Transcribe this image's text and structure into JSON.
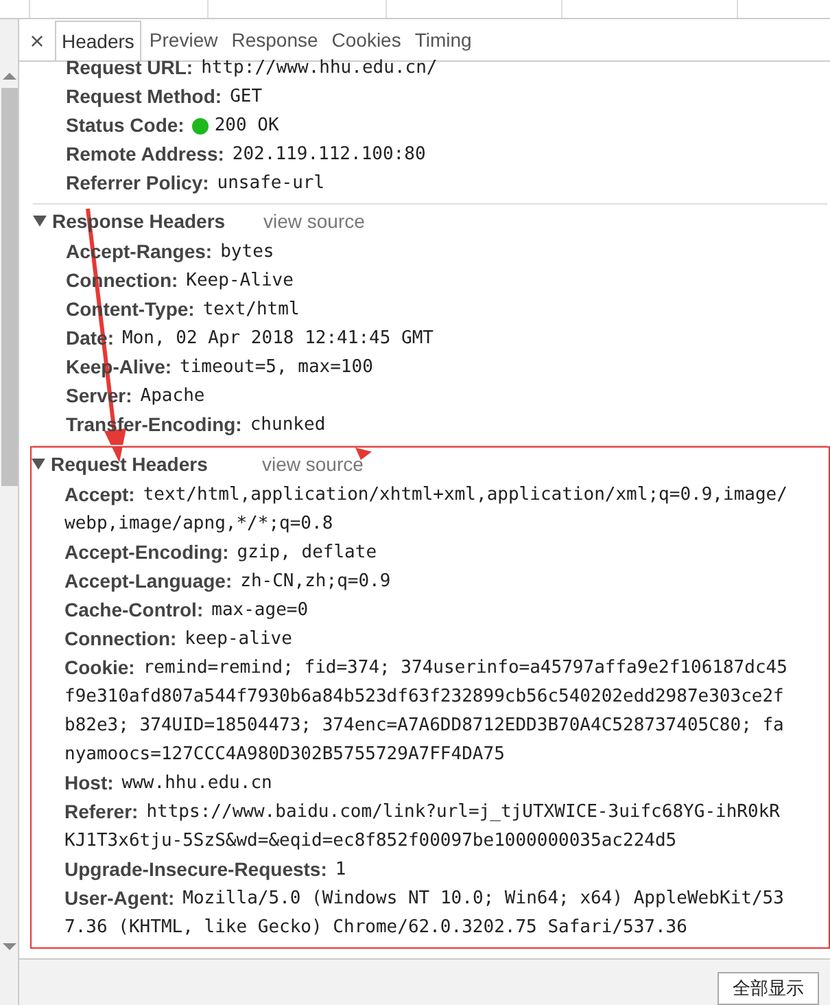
{
  "tabs": [
    {
      "label": "Headers",
      "selected": true
    },
    {
      "label": "Preview",
      "selected": false
    },
    {
      "label": "Response",
      "selected": false
    },
    {
      "label": "Cookies",
      "selected": false
    },
    {
      "label": "Timing",
      "selected": false
    }
  ],
  "close": "×",
  "general": [
    {
      "kind": "text",
      "name": "Request URL:",
      "lines": [
        "http://www.hhu.edu.cn/"
      ]
    },
    {
      "kind": "text",
      "name": "Request Method:",
      "lines": [
        "GET"
      ]
    },
    {
      "kind": "status",
      "name": "Status Code:",
      "color": "#1fb81f",
      "lines": [
        "200 OK"
      ]
    },
    {
      "kind": "text",
      "name": "Remote Address:",
      "lines": [
        "202.119.112.100:80"
      ]
    },
    {
      "kind": "text",
      "name": "Referrer Policy:",
      "lines": [
        "unsafe-url"
      ]
    }
  ],
  "sections": [
    {
      "title": "Response Headers",
      "link": "view source",
      "expanded": true,
      "highlighted": false,
      "rows": [
        {
          "name": "Accept-Ranges:",
          "lines": [
            "bytes"
          ]
        },
        {
          "name": "Connection:",
          "lines": [
            "Keep-Alive"
          ]
        },
        {
          "name": "Content-Type:",
          "lines": [
            "text/html"
          ]
        },
        {
          "name": "Date:",
          "lines": [
            "Mon, 02 Apr 2018 12:41:45 GMT"
          ]
        },
        {
          "name": "Keep-Alive:",
          "lines": [
            "timeout=5, max=100"
          ]
        },
        {
          "name": "Server:",
          "lines": [
            "Apache"
          ]
        },
        {
          "name": "Transfer-Encoding:",
          "lines": [
            "chunked"
          ]
        }
      ]
    },
    {
      "title": "Request Headers",
      "link": "view source",
      "expanded": true,
      "highlighted": true,
      "rows": [
        {
          "name": "Accept:",
          "lines": [
            "text/html,application/xhtml+xml,application/xml;q=0.9,image/",
            "webp,image/apng,*/*;q=0.8"
          ]
        },
        {
          "name": "Accept-Encoding:",
          "lines": [
            "gzip, deflate"
          ]
        },
        {
          "name": "Accept-Language:",
          "lines": [
            "zh-CN,zh;q=0.9"
          ]
        },
        {
          "name": "Cache-Control:",
          "lines": [
            "max-age=0"
          ]
        },
        {
          "name": "Connection:",
          "lines": [
            "keep-alive"
          ]
        },
        {
          "name": "Cookie:",
          "lines": [
            "remind=remind; fid=374; 374userinfo=a45797affa9e2f106187dc45",
            "f9e310afd807a544f7930b6a84b523df63f232899cb56c540202edd2987e303ce2f",
            "b82e3; 374UID=18504473; 374enc=A7A6DD8712EDD3B70A4C528737405C80; fa",
            "nyamoocs=127CCC4A980D302B5755729A7FF4DA75"
          ]
        },
        {
          "name": "Host:",
          "lines": [
            "www.hhu.edu.cn"
          ]
        },
        {
          "name": "Referer:",
          "lines": [
            "https://www.baidu.com/link?url=j_tjUTXWICE-3uifc68YG-ihR0kR",
            "KJ1T3x6tju-5SzS&wd=&eqid=ec8f852f00097be1000000035ac224d5"
          ]
        },
        {
          "name": "Upgrade-Insecure-Requests:",
          "lines": [
            "1"
          ]
        },
        {
          "name": "User-Agent:",
          "lines": [
            "Mozilla/5.0 (Windows NT 10.0; Win64; x64) AppleWebKit/53",
            "7.36 (KHTML, like Gecko) Chrome/62.0.3202.75 Safari/537.36"
          ]
        }
      ]
    }
  ],
  "footer_button": "全部显示"
}
